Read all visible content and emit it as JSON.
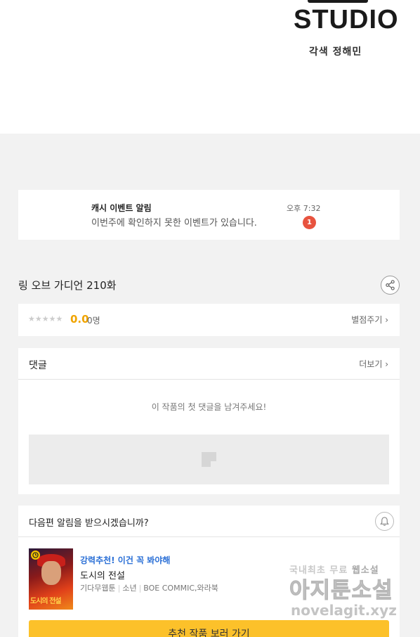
{
  "header": {
    "studio_logo": "STUDIO",
    "colorist": "각색 정해민"
  },
  "notification": {
    "title": "캐시 이벤트 알림",
    "message": "이번주에 확인하지 못한 이벤트가 있습니다.",
    "time": "오후 7:32",
    "badge": "1"
  },
  "episode": {
    "title": "링 오브 가디언 210화",
    "share_icon": "share-icon"
  },
  "rating": {
    "stars": "★★★★★",
    "score": "0.0",
    "count": "0명",
    "rate_link": "별점주기 ›"
  },
  "comments": {
    "title": "댓글",
    "more_link": "더보기 ›",
    "empty_message": "이 작품의 첫 댓글을 남겨주세요!"
  },
  "recommend": {
    "question": "다음편 알림을 받으시겠습니까?",
    "bell_icon": "bell-icon",
    "tag": "강력추천! 이건 꼭 봐야해",
    "work_title": "도시의 전설",
    "meta": [
      "기다무웹툰",
      "소년",
      "BOE COMMIC,와라북"
    ],
    "thumbnail_text": "도시의 전설",
    "button": "추천 작품 보러 가기"
  },
  "watermark": {
    "line1_a": "국내최초 무료 ",
    "line1_b": "웹소설",
    "line2": "아지툰소설",
    "line3": "novelagit.xyz"
  },
  "colors": {
    "accent_yellow": "#fcc12a",
    "badge_red": "#e8533f",
    "score_orange": "#f0a400",
    "tag_blue": "#2a6fd6"
  }
}
